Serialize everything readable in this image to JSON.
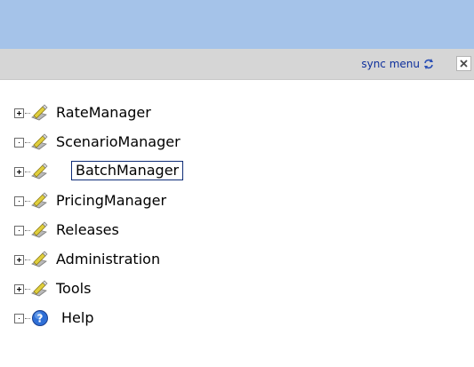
{
  "toolbar": {
    "sync_label": "sync menu",
    "sync_icon": "sync-arrows-icon",
    "close_icon": "close-x-icon"
  },
  "colors": {
    "header_band": "#a5c3e9",
    "toolbar_bg": "#d6d6d6",
    "link": "#0d2f9c",
    "selection_border": "#0f2d78"
  },
  "tree": {
    "items": [
      {
        "label": "RateManager",
        "expander": "plus",
        "icon": "pencil-folder-icon"
      },
      {
        "label": "ScenarioManager",
        "expander": "dot",
        "icon": "pencil-folder-icon"
      },
      {
        "label": "BatchManager",
        "expander": "plus",
        "icon": "pencil-folder-icon",
        "selected": true
      },
      {
        "label": "PricingManager",
        "expander": "dot",
        "icon": "pencil-folder-icon"
      },
      {
        "label": "Releases",
        "expander": "dot",
        "icon": "pencil-folder-icon"
      },
      {
        "label": "Administration",
        "expander": "plus",
        "icon": "pencil-folder-icon"
      },
      {
        "label": "Tools",
        "expander": "plus",
        "icon": "pencil-folder-icon"
      },
      {
        "label": "Help",
        "expander": "dot",
        "icon": "help-question-icon"
      }
    ]
  }
}
